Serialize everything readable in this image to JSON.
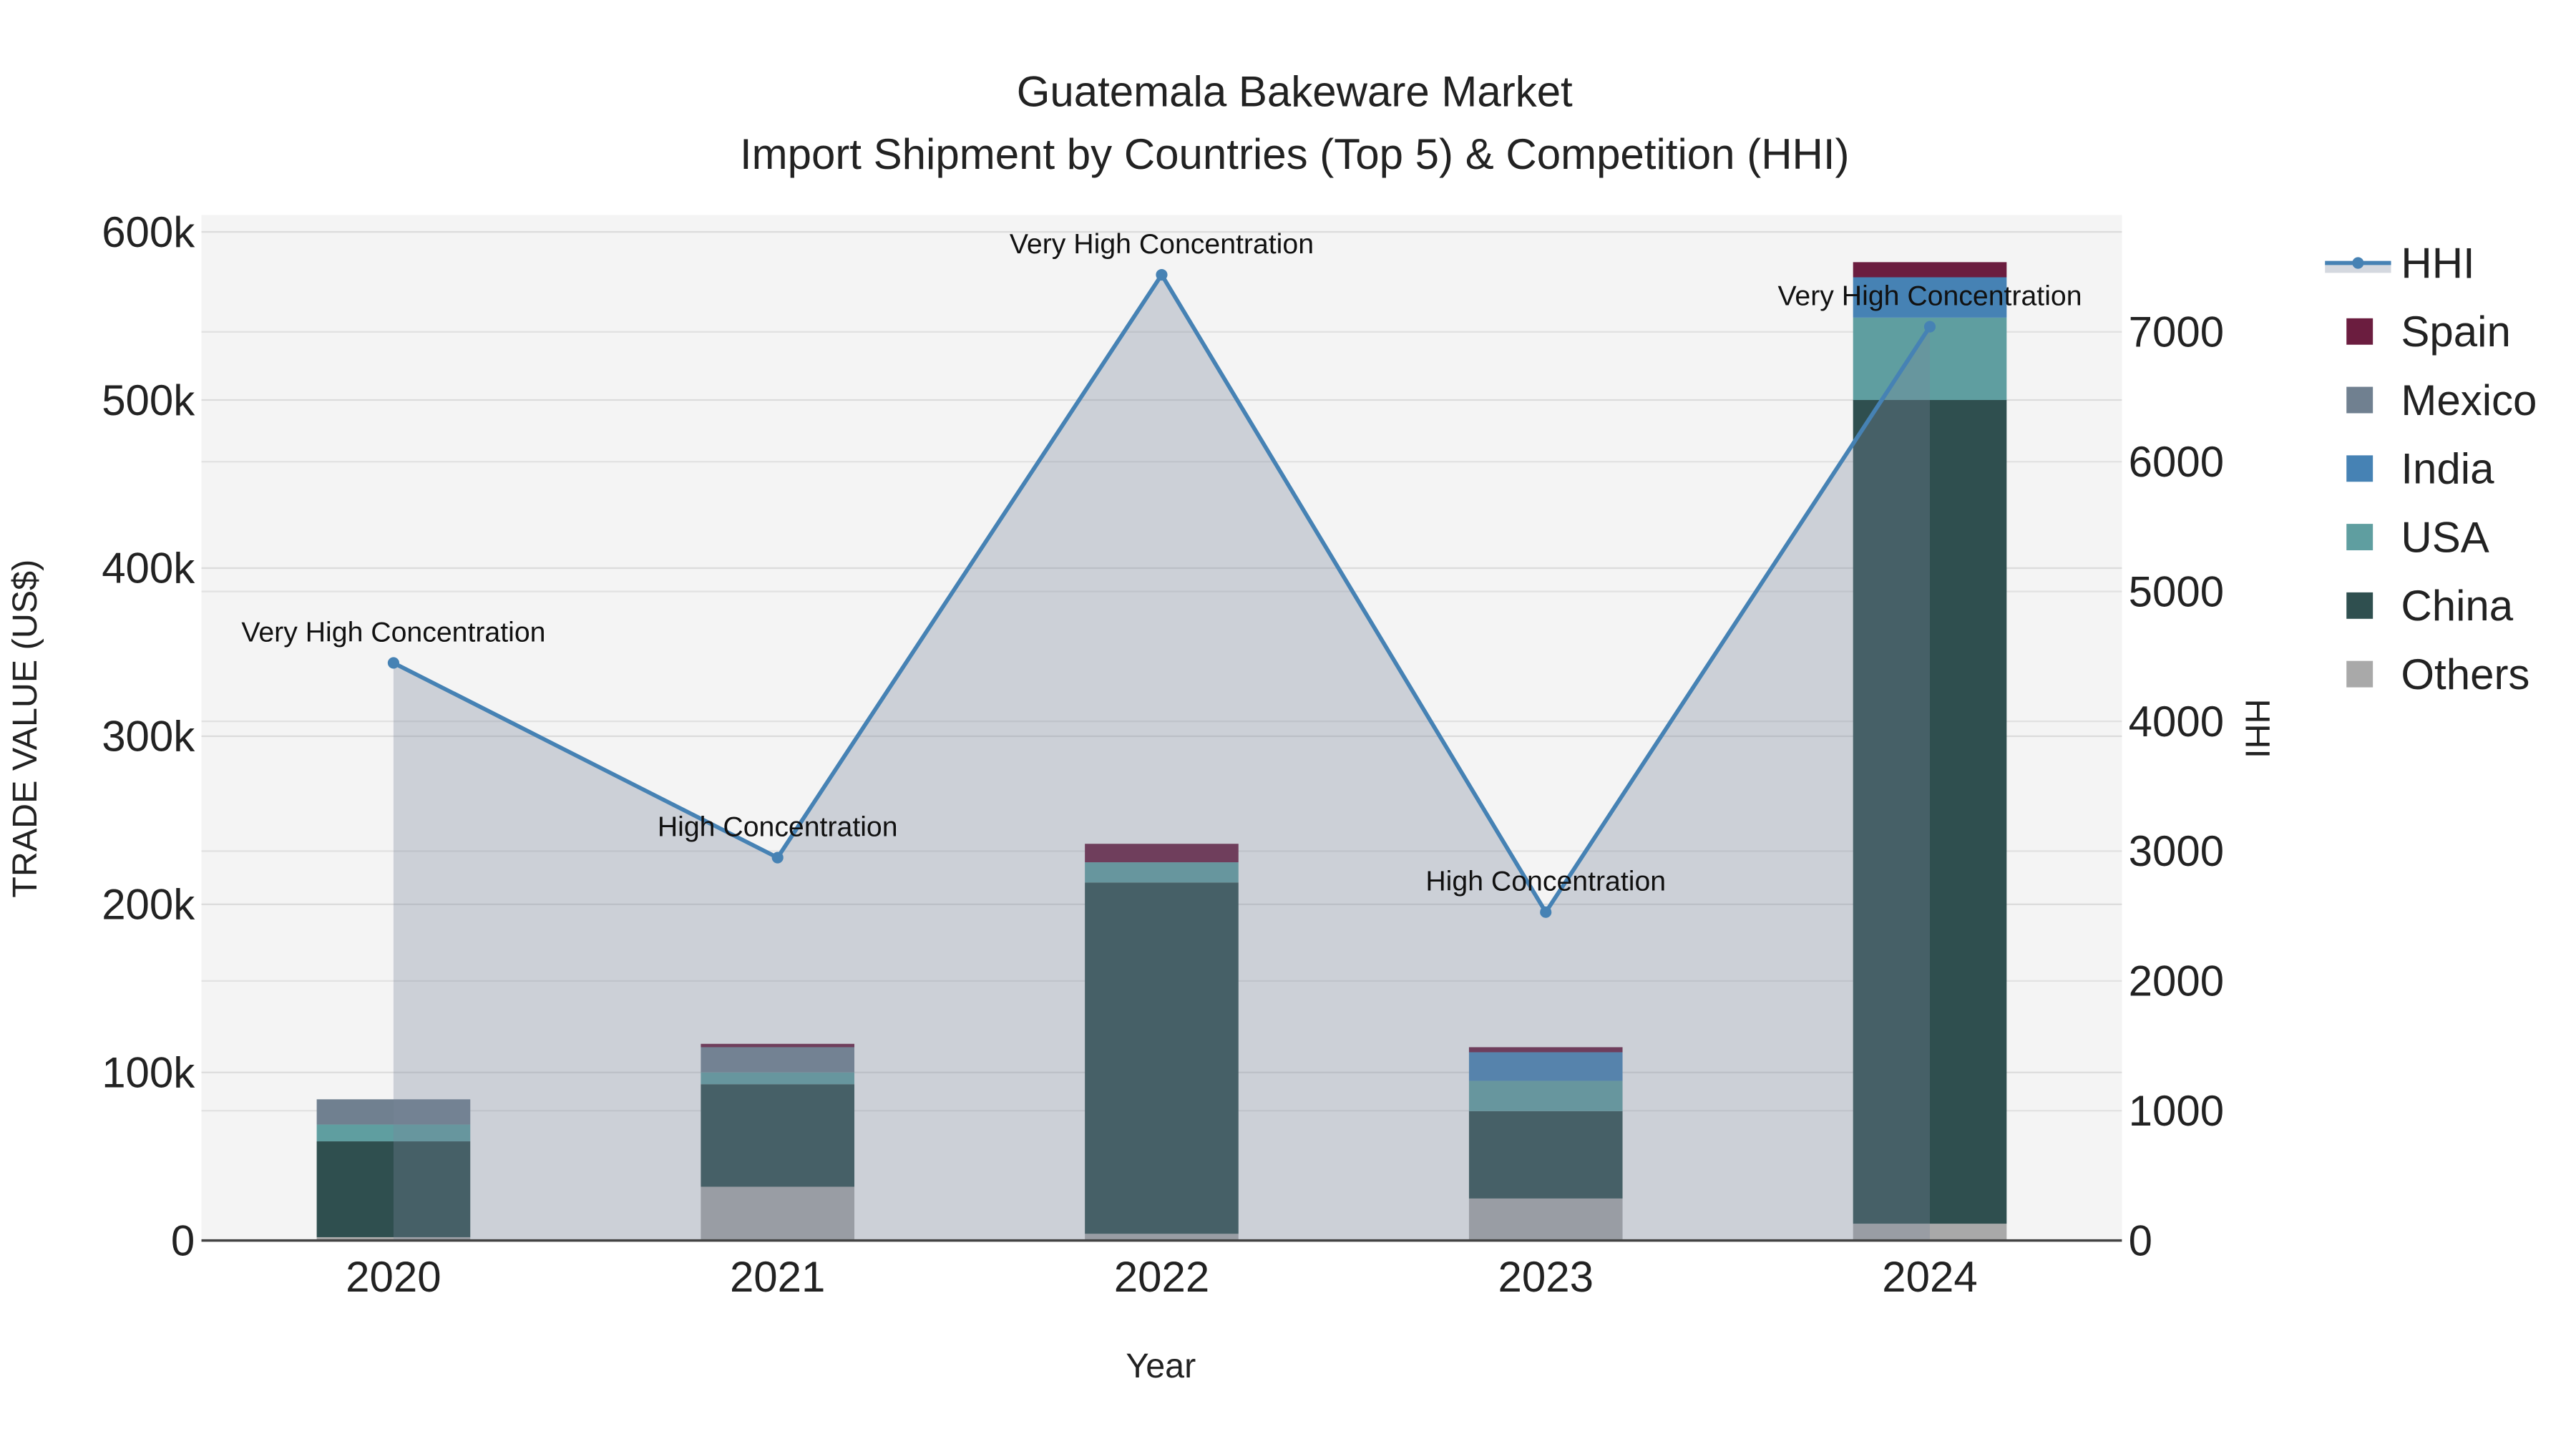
{
  "chart_data": {
    "type": "bar",
    "title": "Guatemala Bakeware Market",
    "subtitle": "Import Shipment by Countries (Top 5) & Competition (HHI)",
    "xlabel": "Year",
    "ylabel": "TRADE VALUE (US$)",
    "y2label": "HHI",
    "categories": [
      "2020",
      "2021",
      "2022",
      "2023",
      "2024"
    ],
    "ylim": [
      0,
      610000
    ],
    "y2lim": [
      0,
      7900
    ],
    "yticks": [
      0,
      100000,
      200000,
      300000,
      400000,
      500000,
      600000
    ],
    "ytick_labels": [
      "0",
      "100k",
      "200k",
      "300k",
      "400k",
      "500k",
      "600k"
    ],
    "y2ticks": [
      0,
      1000,
      2000,
      3000,
      4000,
      5000,
      6000,
      7000
    ],
    "y2tick_labels": [
      "0",
      "1000",
      "2000",
      "3000",
      "4000",
      "5000",
      "6000",
      "7000"
    ],
    "grid": true,
    "legend_position": "right",
    "series": [
      {
        "name": "Others",
        "color": "#a9a9a9",
        "values": [
          2000,
          32000,
          4000,
          25000,
          10000
        ]
      },
      {
        "name": "China",
        "color": "#2f4f4f",
        "values": [
          57000,
          61000,
          209000,
          52000,
          490000
        ]
      },
      {
        "name": "USA",
        "color": "#5f9ea0",
        "values": [
          10000,
          7000,
          12000,
          18000,
          49000
        ]
      },
      {
        "name": "India",
        "color": "#4682b4",
        "values": [
          0,
          0,
          0,
          17000,
          24000
        ]
      },
      {
        "name": "Mexico",
        "color": "#708090",
        "values": [
          15000,
          15000,
          0,
          0,
          0
        ]
      },
      {
        "name": "Spain",
        "color": "#6b1d3f",
        "values": [
          0,
          2000,
          11000,
          3000,
          9000
        ]
      }
    ],
    "line": {
      "name": "HHI",
      "color": "#4682b4",
      "values": [
        4450,
        2950,
        7440,
        2530,
        7040
      ],
      "annotations": [
        "Very High Concentration",
        "High Concentration",
        "Very High Concentration",
        "High Concentration",
        "Very High Concentration"
      ]
    },
    "legend_order": [
      "HHI",
      "Spain",
      "Mexico",
      "India",
      "USA",
      "China",
      "Others"
    ]
  }
}
